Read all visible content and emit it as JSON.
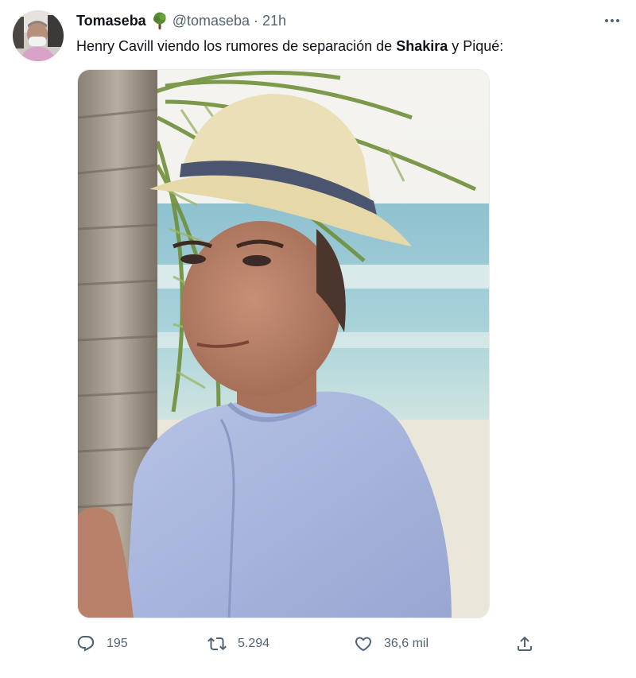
{
  "author": {
    "display_name": "Tomaseba",
    "badge_icon": "tree-emoji-icon",
    "handle": "@tomaseba",
    "separator": "·",
    "time": "21h"
  },
  "tweet": {
    "text_before": "Henry Cavill viendo los rumores de separación de ",
    "text_bold": "Shakira",
    "text_after": " y Piqué:"
  },
  "media": {
    "description_icon": "photo-man-with-straw-hat-under-palm-tree"
  },
  "actions": {
    "reply_count": "195",
    "retweet_count": "5.294",
    "like_count": "36,6 mil"
  },
  "icons": {
    "more": "more-horizontal-icon",
    "reply": "reply-icon",
    "retweet": "retweet-icon",
    "like": "heart-icon",
    "share": "share-icon"
  },
  "colors": {
    "text_primary": "#0f1419",
    "text_secondary": "#536471",
    "border": "#e7e9ea"
  }
}
